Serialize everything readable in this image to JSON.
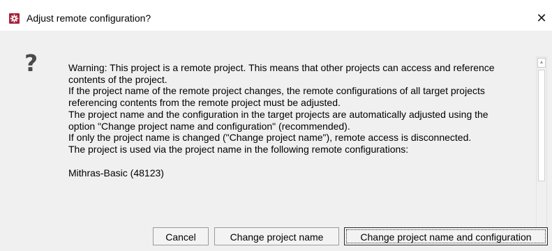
{
  "window": {
    "title": "Adjust remote configuration?",
    "close_label": "✕"
  },
  "dialog": {
    "icon": "question-icon",
    "icon_glyph": "?",
    "message_lines": [
      "Warning: This project is a remote project. This means that other projects can access and reference",
      "contents of the project.",
      "If the project name of the remote project changes, the remote configurations of all target projects",
      "referencing contents from the remote project must be adjusted.",
      "The project name and the configuration in the target projects are automatically adjusted using the",
      "option \"Change project name and configuration\" (recommended).",
      "If only the project name is changed (\"Change project name\"), remote access is disconnected.",
      "The project is used via the project name in the following remote configurations:",
      "",
      "Mithras-Basic (48123)"
    ]
  },
  "buttons": {
    "cancel": "Cancel",
    "change_name": "Change project name",
    "change_name_and_config": "Change project name and configuration"
  },
  "colors": {
    "app_icon": "#a8203a",
    "dialog_background": "#f0f0f0",
    "titlebar_background": "#ffffff"
  }
}
